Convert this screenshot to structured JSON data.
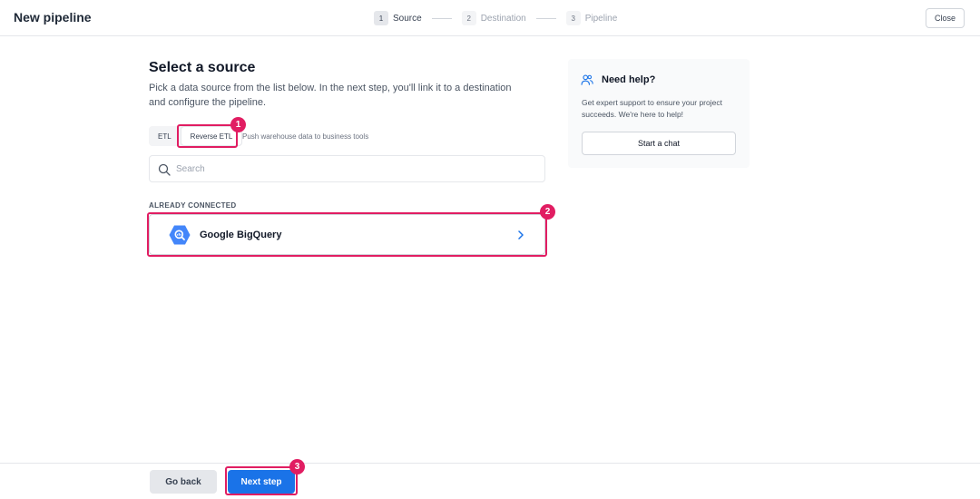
{
  "header": {
    "title": "New pipeline",
    "close_label": "Close",
    "steps": [
      {
        "num": "1",
        "label": "Source",
        "active": true
      },
      {
        "num": "2",
        "label": "Destination",
        "active": false
      },
      {
        "num": "3",
        "label": "Pipeline",
        "active": false
      }
    ]
  },
  "main": {
    "title": "Select a source",
    "subtitle": "Pick a data source from the list below. In the next step, you'll link it to a destination and configure the pipeline.",
    "tabs": [
      {
        "label": "ETL",
        "active": false
      },
      {
        "label": "Reverse ETL",
        "active": true
      }
    ],
    "tab_description": "Push warehouse data to business tools",
    "search": {
      "placeholder": "Search",
      "value": ""
    },
    "section_label": "ALREADY CONNECTED",
    "sources": [
      {
        "name": "Google BigQuery",
        "icon": "google-bigquery-icon"
      }
    ]
  },
  "help": {
    "title": "Need help?",
    "text": "Get expert support to ensure your project succeeds. We're here to help!",
    "button_label": "Start a chat"
  },
  "footer": {
    "back_label": "Go back",
    "next_label": "Next step"
  },
  "annotations": [
    {
      "number": "1",
      "target": "Reverse ETL tab"
    },
    {
      "number": "2",
      "target": "Google BigQuery source"
    },
    {
      "number": "3",
      "target": "Next step button"
    }
  ],
  "colors": {
    "accent": "#1a73e8",
    "highlight": "#e11d62"
  }
}
